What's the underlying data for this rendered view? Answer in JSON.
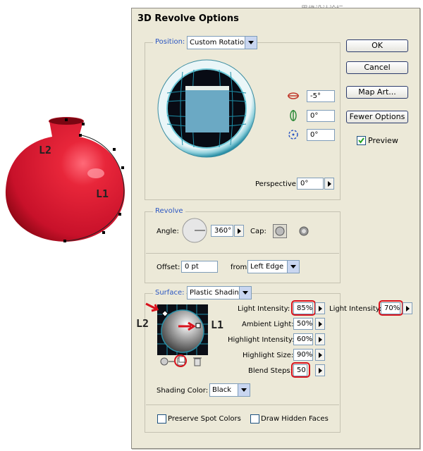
{
  "watermark": "思缘设计论坛 WWW.MISSYUAN.COM",
  "illustration": {
    "label_left": "L2",
    "label_right": "L1"
  },
  "dialog": {
    "title": "3D Revolve Options",
    "position": {
      "label": "Position:",
      "value": "Custom Rotation",
      "x_angle": "-5°",
      "y_angle": "0°",
      "z_angle": "0°",
      "perspective_label": "Perspective:",
      "perspective_value": "0°"
    },
    "buttons": {
      "ok": "OK",
      "cancel": "Cancel",
      "map_art": "Map Art...",
      "fewer_options": "Fewer Options"
    },
    "preview": {
      "label": "Preview",
      "checked": true
    },
    "revolve": {
      "title": "Revolve",
      "angle_label": "Angle:",
      "angle_value": "360°",
      "cap_label": "Cap:",
      "offset_label": "Offset:",
      "offset_value": "0 pt",
      "from_label": "from",
      "from_value": "Left Edge"
    },
    "surface": {
      "label": "Surface:",
      "value": "Plastic Shading",
      "light_intensity_label": "Light Intensity:",
      "light_intensity_value": "85%",
      "light_intensity_2_label": "Light Intensity:",
      "light_intensity_2_value": "70%",
      "ambient_label": "Ambient Light:",
      "ambient_value": "50%",
      "highlight_intensity_label": "Highlight Intensity:",
      "highlight_intensity_value": "60%",
      "highlight_size_label": "Highlight Size:",
      "highlight_size_value": "90%",
      "blend_steps_label": "Blend Steps:",
      "blend_steps_value": "50",
      "shading_color_label": "Shading Color:",
      "shading_color_value": "Black",
      "sphere_label_left": "L2",
      "sphere_label_right": "L1"
    },
    "preserve_spot": {
      "label": "Preserve Spot Colors",
      "checked": false
    },
    "draw_hidden": {
      "label": "Draw Hidden Faces",
      "checked": false
    }
  },
  "colors": {
    "vase_red": "#d8192a",
    "highlight_box": "#d8121d",
    "legend_blue": "#2b56c2"
  },
  "icons": {
    "x_axis": "rotate-x-icon",
    "y_axis": "rotate-y-icon",
    "z_axis": "rotate-z-icon",
    "new_light": "new-light-icon",
    "delete_light": "trash-icon"
  }
}
